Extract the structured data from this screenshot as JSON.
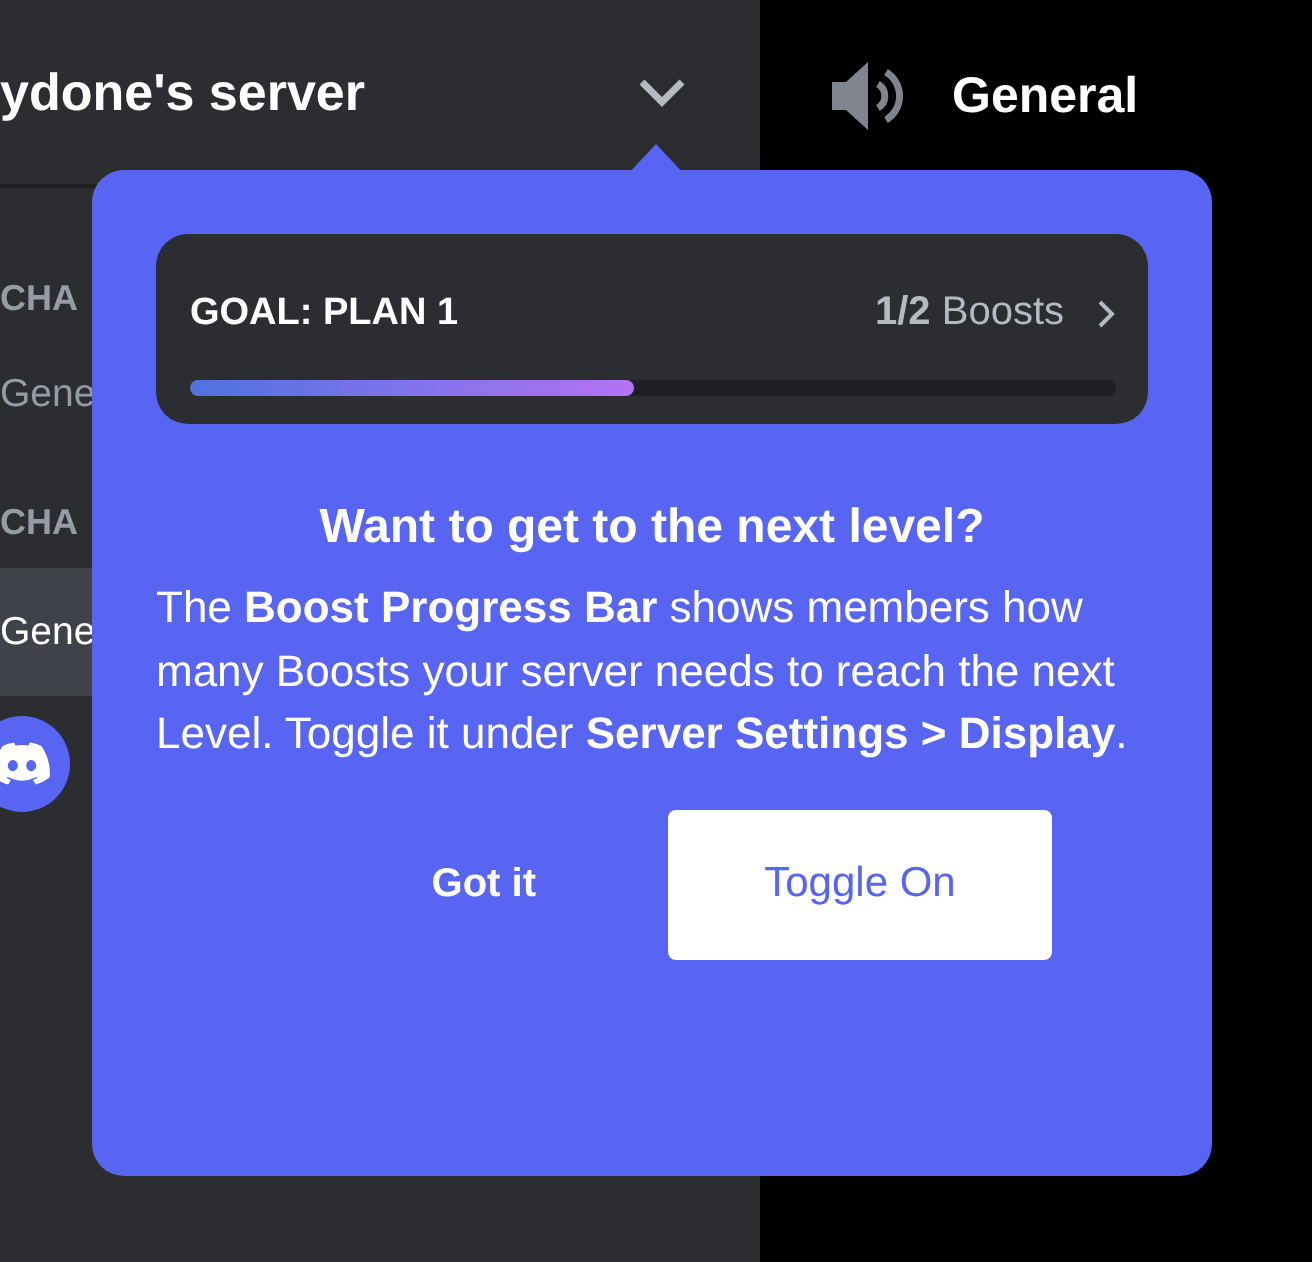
{
  "server_header": {
    "name": "ydone's server"
  },
  "channel_list": [
    {
      "kind": "category",
      "label": "CHA"
    },
    {
      "kind": "channel",
      "label": "Gene",
      "selected": false
    },
    {
      "kind": "category",
      "label": "CHA"
    },
    {
      "kind": "channel",
      "label": "Gene",
      "selected": true
    },
    {
      "kind": "avatar"
    }
  ],
  "channel_header": {
    "name": "General"
  },
  "popup": {
    "goal": {
      "title": "GOAL: PLAN 1",
      "progress": "**1/2** Boosts",
      "level": 0.48
    },
    "heading": "Want to get to the next level?",
    "body": "The **Boost Progress Bar** shows members how many Boosts your server needs to reach the next Level. Toggle it under **Server Settings > Display**.",
    "buttons": [
      {
        "kind": "text",
        "label": "Got it"
      },
      {
        "kind": "primary",
        "label": "Toggle On"
      }
    ]
  }
}
